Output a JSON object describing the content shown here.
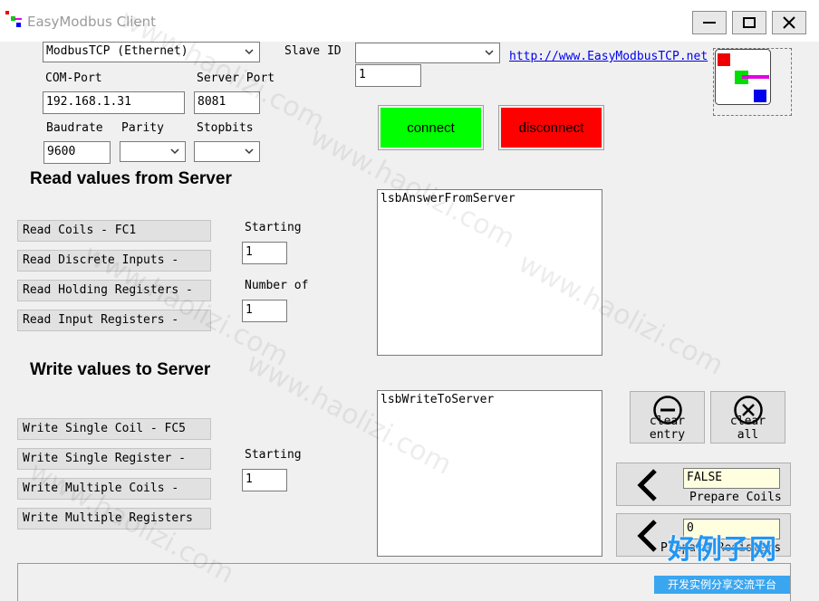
{
  "window": {
    "title": "EasyModbus Client"
  },
  "connection": {
    "mode_value": "ModbusTCP (Ethernet)",
    "slave_id_label": "Slave ID",
    "slave_id_combo_value": "",
    "slave_id_value": "1",
    "com_port_label": "COM-Port",
    "server_port_label": "Server Port",
    "ip_value": "192.168.1.31",
    "port_value": "8081",
    "baudrate_label": "Baudrate",
    "parity_label": "Parity",
    "stopbits_label": "Stopbits",
    "baudrate_value": "9600",
    "parity_value": "",
    "stopbits_value": "",
    "url": "http://www.EasyModbusTCP.net",
    "connect_label": "connect",
    "disconnect_label": "disconnect"
  },
  "read": {
    "title": "Read values from Server",
    "buttons": [
      "Read Coils - FC1",
      "Read Discrete Inputs -",
      "Read Holding Registers -",
      "Read Input Registers -"
    ],
    "starting_label": "Starting",
    "starting_value": "1",
    "number_label": "Number of",
    "number_value": "1",
    "answer_list": "lsbAnswerFromServer"
  },
  "write": {
    "title": "Write values to Server",
    "buttons": [
      "Write Single Coil - FC5",
      "Write Single Register -",
      "Write Multiple Coils -",
      "Write Multiple Registers"
    ],
    "starting_label": "Starting",
    "starting_value": "1",
    "write_list": "lsbWriteToServer",
    "clear_entry_line1": "clear",
    "clear_entry_line2": "entry",
    "clear_all_line1": "clear",
    "clear_all_line2": "all",
    "coils_value": "FALSE",
    "prepare_coils_label": "Prepare Coils",
    "register_value": "0",
    "prepare_registers_label": "Prepare Registers"
  },
  "colors": {
    "connect": "#00ff00",
    "disconnect": "#ff0000"
  },
  "watermarks": {
    "text": "www.haolizi.com",
    "brand_main": "好例子网",
    "brand_sub": "开发实例分享交流平台"
  }
}
